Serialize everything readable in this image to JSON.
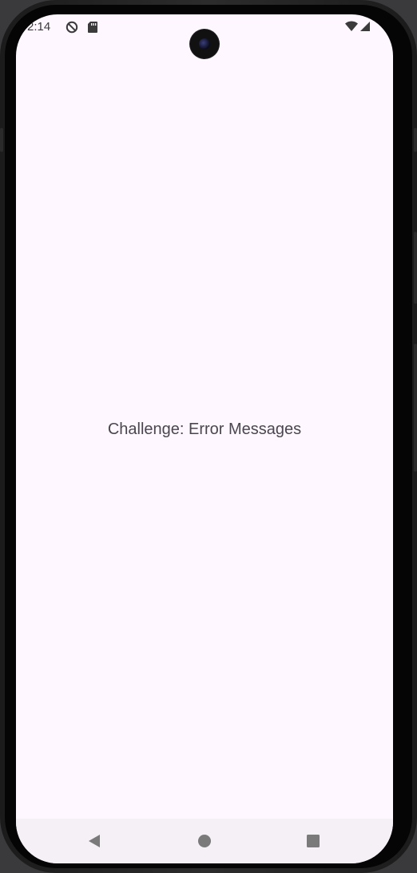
{
  "status_bar": {
    "time": "2:14",
    "icons": [
      "do-not-disturb-icon",
      "sd-card-icon",
      "wifi-icon",
      "signal-icon"
    ]
  },
  "main": {
    "message": "Challenge: Error Messages"
  },
  "nav_bar": {
    "buttons": [
      "back-icon",
      "home-icon",
      "recents-icon"
    ]
  },
  "colors": {
    "screen_background": "#fef7ff",
    "text": "#4a4650",
    "nav_icons": "#7a7a7a"
  }
}
